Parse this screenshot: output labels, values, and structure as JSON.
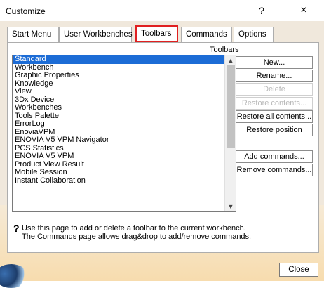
{
  "window": {
    "title": "Customize",
    "help_glyph": "?",
    "close_glyph": "×"
  },
  "tabs": [
    {
      "label": "Start Menu",
      "active": false
    },
    {
      "label": "User Workbenches",
      "active": false
    },
    {
      "label": "Toolbars",
      "active": true
    },
    {
      "label": "Commands",
      "active": false
    },
    {
      "label": "Options",
      "active": false
    }
  ],
  "toolbars_panel": {
    "list_label": "Toolbars",
    "items": [
      "Standard",
      "Workbench",
      "Graphic Properties",
      "Knowledge",
      "View",
      "3Dx Device",
      "Workbenches",
      "Tools Palette",
      "ErrorLog",
      "EnoviaVPM",
      "ENOVIA V5 VPM Navigator",
      "PCS Statistics",
      "ENOVIA V5 VPM",
      "Product View Result",
      "Mobile Session",
      "Instant Collaboration"
    ],
    "selected_index": 0,
    "buttons": {
      "new": "New...",
      "rename": "Rename...",
      "delete": "Delete",
      "restore_contents": "Restore contents...",
      "restore_all_contents": "Restore all contents...",
      "restore_position": "Restore position",
      "add_commands": "Add commands...",
      "remove_commands": "Remove commands..."
    },
    "disabled_buttons": [
      "delete",
      "restore_contents"
    ],
    "help": {
      "icon": "?",
      "line1": "Use this page to add or delete a toolbar to the current workbench.",
      "line2": "The Commands page allows drag&drop to add/remove commands."
    }
  },
  "footer": {
    "close_label": "Close"
  },
  "colors": {
    "selection": "#1c6cd6",
    "active_tab_outline": "#e02020",
    "dialog_background": "#f0e8dc"
  }
}
